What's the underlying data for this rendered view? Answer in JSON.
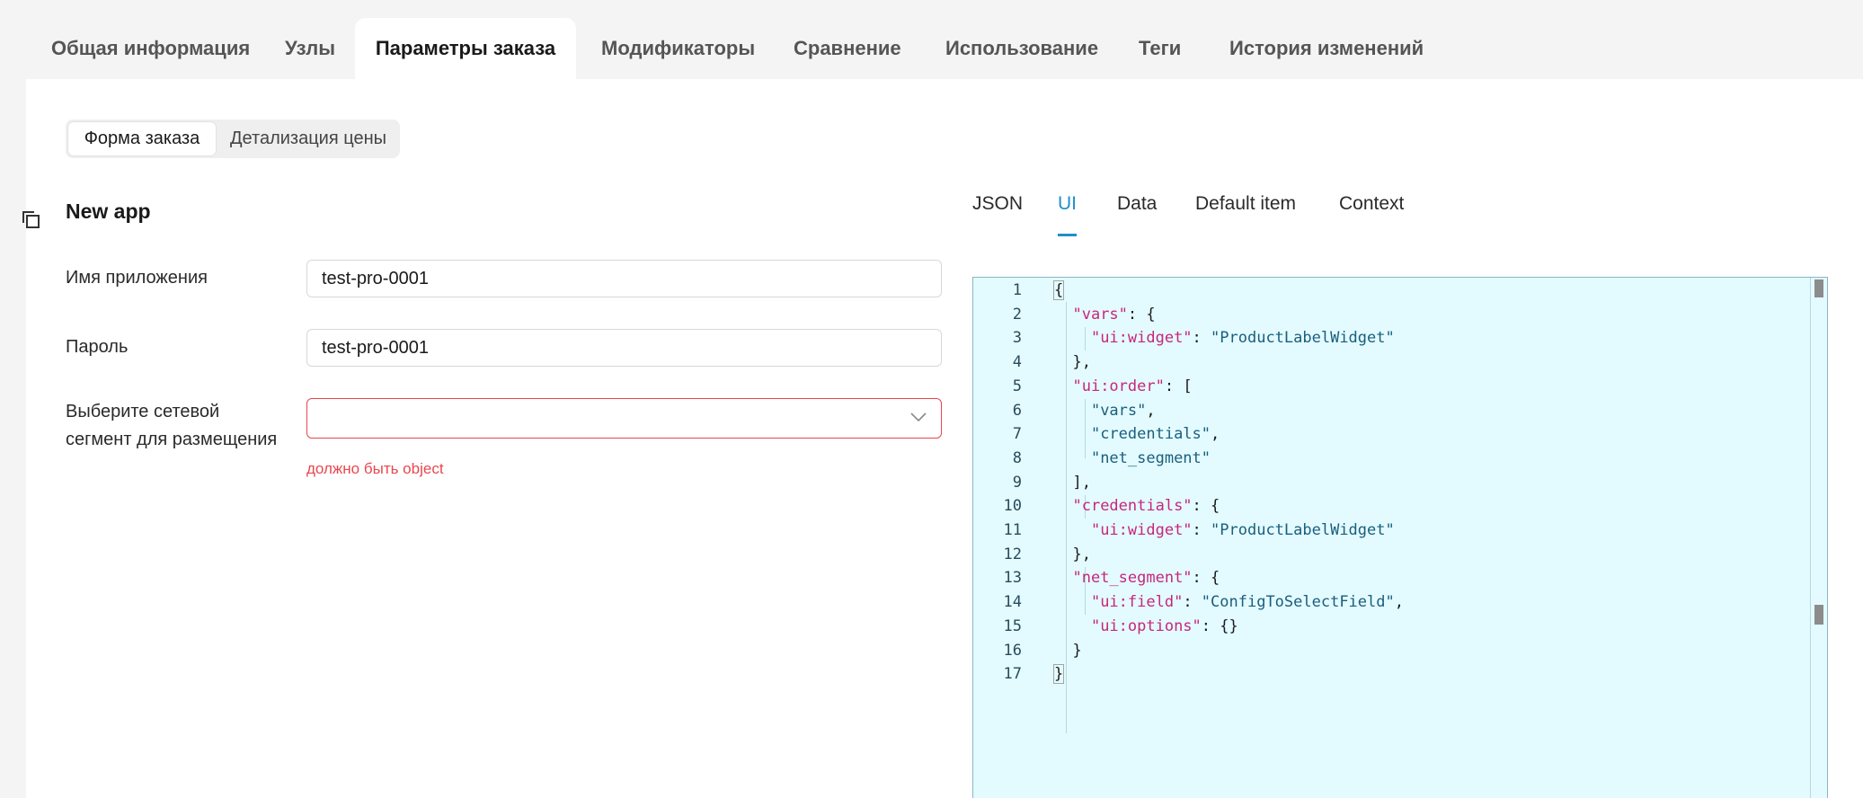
{
  "top_tabs": [
    {
      "label": "Общая информация",
      "active": false
    },
    {
      "label": "Узлы",
      "active": false
    },
    {
      "label": "Параметры заказа",
      "active": true
    },
    {
      "label": "Модификаторы",
      "active": false
    },
    {
      "label": "Сравнение",
      "active": false
    },
    {
      "label": "Использование",
      "active": false
    },
    {
      "label": "Теги",
      "active": false
    },
    {
      "label": "История изменений",
      "active": false
    }
  ],
  "segmented": {
    "order_form": "Форма заказа",
    "price_details": "Детализация цены",
    "active": "order_form"
  },
  "form": {
    "title": "New app",
    "app_name_label": "Имя приложения",
    "app_name_value": "test-pro-0001",
    "password_label": "Пароль",
    "password_value": "test-pro-0001",
    "segment_label_line1": "Выберите сетевой",
    "segment_label_line2": "сегмент для размещения",
    "segment_value": "",
    "segment_error": "должно быть object"
  },
  "editor_tabs": [
    {
      "label": "JSON",
      "active": false
    },
    {
      "label": "UI",
      "active": true
    },
    {
      "label": "Data",
      "active": false
    },
    {
      "label": "Default item",
      "active": false
    },
    {
      "label": "Context",
      "active": false
    }
  ],
  "code": {
    "line_numbers": [
      "1",
      "2",
      "3",
      "4",
      "5",
      "6",
      "7",
      "8",
      "9",
      "10",
      "11",
      "12",
      "13",
      "14",
      "15",
      "16",
      "17"
    ],
    "lines": [
      [
        {
          "t": "p",
          "v": "{"
        }
      ],
      [
        {
          "t": "p",
          "v": "  "
        },
        {
          "t": "k",
          "v": "\"vars\""
        },
        {
          "t": "p",
          "v": ": {"
        }
      ],
      [
        {
          "t": "p",
          "v": "    "
        },
        {
          "t": "k",
          "v": "\"ui:widget\""
        },
        {
          "t": "p",
          "v": ": "
        },
        {
          "t": "s",
          "v": "\"ProductLabelWidget\""
        }
      ],
      [
        {
          "t": "p",
          "v": "  },"
        }
      ],
      [
        {
          "t": "p",
          "v": "  "
        },
        {
          "t": "k",
          "v": "\"ui:order\""
        },
        {
          "t": "p",
          "v": ": ["
        }
      ],
      [
        {
          "t": "p",
          "v": "    "
        },
        {
          "t": "s",
          "v": "\"vars\""
        },
        {
          "t": "p",
          "v": ","
        }
      ],
      [
        {
          "t": "p",
          "v": "    "
        },
        {
          "t": "s",
          "v": "\"credentials\""
        },
        {
          "t": "p",
          "v": ","
        }
      ],
      [
        {
          "t": "p",
          "v": "    "
        },
        {
          "t": "s",
          "v": "\"net_segment\""
        }
      ],
      [
        {
          "t": "p",
          "v": "  ],"
        }
      ],
      [
        {
          "t": "p",
          "v": "  "
        },
        {
          "t": "k",
          "v": "\"credentials\""
        },
        {
          "t": "p",
          "v": ": {"
        }
      ],
      [
        {
          "t": "p",
          "v": "    "
        },
        {
          "t": "k",
          "v": "\"ui:widget\""
        },
        {
          "t": "p",
          "v": ": "
        },
        {
          "t": "s",
          "v": "\"ProductLabelWidget\""
        }
      ],
      [
        {
          "t": "p",
          "v": "  },"
        }
      ],
      [
        {
          "t": "p",
          "v": "  "
        },
        {
          "t": "k",
          "v": "\"net_segment\""
        },
        {
          "t": "p",
          "v": ": {"
        }
      ],
      [
        {
          "t": "p",
          "v": "    "
        },
        {
          "t": "k",
          "v": "\"ui:field\""
        },
        {
          "t": "p",
          "v": ": "
        },
        {
          "t": "s",
          "v": "\"ConfigToSelectField\""
        },
        {
          "t": "p",
          "v": ","
        }
      ],
      [
        {
          "t": "p",
          "v": "    "
        },
        {
          "t": "k",
          "v": "\"ui:options\""
        },
        {
          "t": "p",
          "v": ": {}"
        }
      ],
      [
        {
          "t": "p",
          "v": "  }"
        }
      ],
      [
        {
          "t": "p",
          "v": "}"
        }
      ]
    ]
  },
  "colors": {
    "accent": "#1e90c8",
    "error": "#e8474f",
    "editor_bg": "#e3fbff",
    "json_key": "#c8267a",
    "json_string": "#1a5e7d"
  },
  "icons": {
    "copy": "copy-icon",
    "chevron": "chevron-down-icon"
  }
}
